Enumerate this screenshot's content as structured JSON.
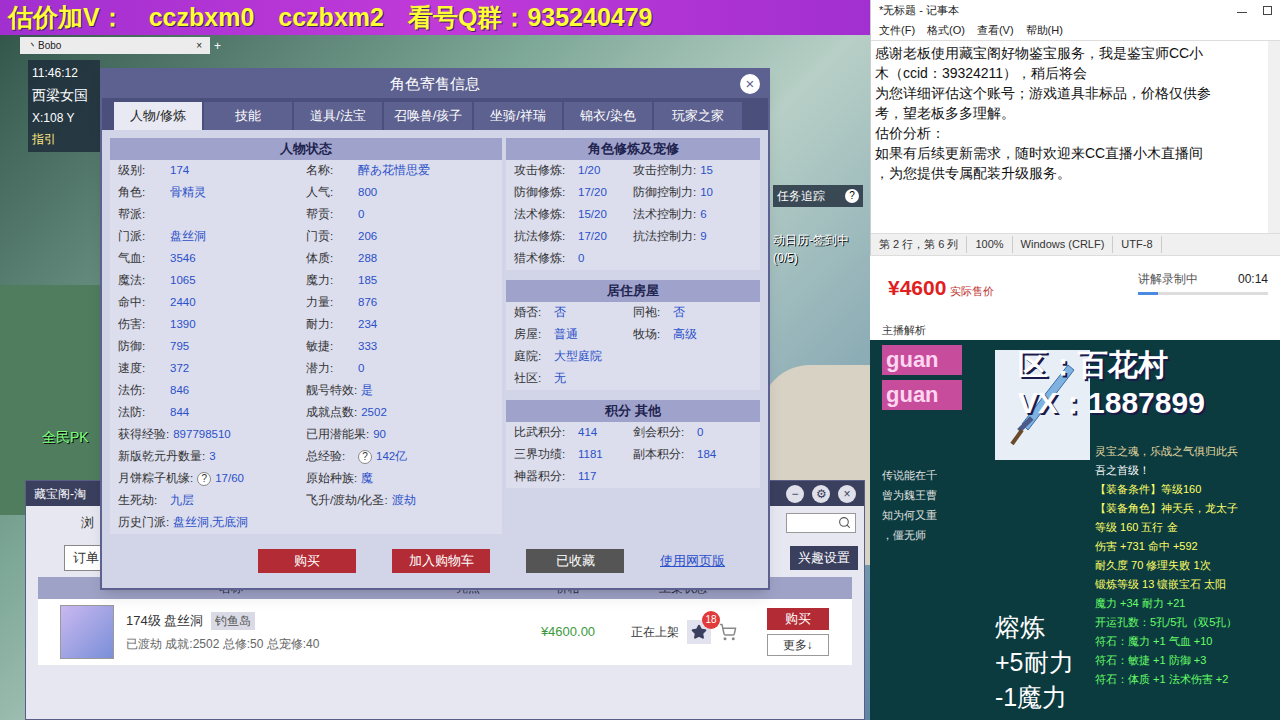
{
  "banner": {
    "segments": [
      "估价加V：",
      "cczbxm0",
      "cczbxm2",
      "看号Q群：935240479"
    ]
  },
  "game": {
    "browser_tab": {
      "title": "丶Bobo",
      "close": "×",
      "add": "+"
    },
    "hud": {
      "time": "11:46:12",
      "map": "西梁女国",
      "coords": "X:108 Y",
      "guide": "指引",
      "pk": "全民PK",
      "task": "任务追踪",
      "task_help": "?",
      "calendar": "动日历-签到中",
      "calendar_count": "(0/5)"
    }
  },
  "dialog": {
    "title": "角色寄售信息",
    "close": "×",
    "tabs": [
      {
        "label": "人物/修炼",
        "selected": true
      },
      {
        "label": "技能",
        "selected": false
      },
      {
        "label": "道具/法宝",
        "selected": false
      },
      {
        "label": "召唤兽/孩子",
        "selected": false
      },
      {
        "label": "坐骑/祥瑞",
        "selected": false
      },
      {
        "label": "锦衣/染色",
        "selected": false
      },
      {
        "label": "玩家之家",
        "selected": false
      }
    ],
    "status": {
      "title": "人物状态",
      "rows": [
        [
          {
            "label": "级别:",
            "value": "174"
          },
          {
            "label": "名称:",
            "value": "醉あ花惜思爱"
          }
        ],
        [
          {
            "label": "角色:",
            "value": "骨精灵"
          },
          {
            "label": "人气:",
            "value": "800"
          }
        ],
        [
          {
            "label": "帮派:",
            "value": ""
          },
          {
            "label": "帮贡:",
            "value": "0"
          }
        ],
        [
          {
            "label": "门派:",
            "value": "盘丝洞"
          },
          {
            "label": "门贡:",
            "value": "206"
          }
        ],
        [
          {
            "label": "气血:",
            "value": "3546"
          },
          {
            "label": "体质:",
            "value": "288"
          }
        ],
        [
          {
            "label": "魔法:",
            "value": "1065"
          },
          {
            "label": "魔力:",
            "value": "185"
          }
        ],
        [
          {
            "label": "命中:",
            "value": "2440"
          },
          {
            "label": "力量:",
            "value": "876"
          }
        ],
        [
          {
            "label": "伤害:",
            "value": "1390"
          },
          {
            "label": "耐力:",
            "value": "234"
          }
        ],
        [
          {
            "label": "防御:",
            "value": "795"
          },
          {
            "label": "敏捷:",
            "value": "333"
          }
        ],
        [
          {
            "label": "速度:",
            "value": "372"
          },
          {
            "label": "潜力:",
            "value": "0"
          }
        ],
        [
          {
            "label": "法伤:",
            "value": "846"
          },
          {
            "label": "靓号特效:",
            "value": "是"
          }
        ],
        [
          {
            "label": "法防:",
            "value": "844"
          },
          {
            "label": "成就点数:",
            "value": "2502"
          }
        ],
        [
          {
            "label": "获得经验:",
            "value": "897798510"
          },
          {
            "label": "已用潜能果:",
            "value": "90"
          }
        ],
        [
          {
            "label": "新版乾元丹数量:",
            "value": "3"
          },
          {
            "label": "总经验:",
            "value": "142亿",
            "hint": "?"
          }
        ],
        [
          {
            "label": "月饼粽子机缘:",
            "value": "17/60",
            "hint": "?"
          },
          {
            "label": "原始种族:",
            "value": "魔"
          }
        ],
        [
          {
            "label": "生死劫:",
            "value": "九层"
          },
          {
            "label": "飞升/渡劫/化圣:",
            "value": "渡劫"
          }
        ],
        [
          {
            "label": "历史门派:",
            "value": "盘丝洞,无底洞"
          }
        ]
      ]
    },
    "cultivation": {
      "title": "角色修炼及宠修",
      "rows": [
        [
          {
            "label": "攻击修炼:",
            "value": "1/20"
          },
          {
            "label": "攻击控制力:",
            "value": "15"
          }
        ],
        [
          {
            "label": "防御修炼:",
            "value": "17/20"
          },
          {
            "label": "防御控制力:",
            "value": "10"
          }
        ],
        [
          {
            "label": "法术修炼:",
            "value": "15/20"
          },
          {
            "label": "法术控制力:",
            "value": "6"
          }
        ],
        [
          {
            "label": "抗法修炼:",
            "value": "17/20"
          },
          {
            "label": "抗法控制力:",
            "value": "9"
          }
        ],
        [
          {
            "label": "猎术修炼:",
            "value": "0"
          }
        ]
      ]
    },
    "housing": {
      "title": "居住房屋",
      "rows": [
        [
          {
            "label": "婚否:",
            "value": "否"
          },
          {
            "label": "同袍:",
            "value": "否"
          }
        ],
        [
          {
            "label": "房屋:",
            "value": "普通"
          },
          {
            "label": "牧场:",
            "value": "高级"
          }
        ],
        [
          {
            "label": "庭院:",
            "value": "大型庭院"
          }
        ],
        [
          {
            "label": "社区:",
            "value": "无"
          }
        ]
      ]
    },
    "points": {
      "title": "积分 其他",
      "rows": [
        [
          {
            "label": "比武积分:",
            "value": "414"
          },
          {
            "label": "剑会积分:",
            "value": "0"
          }
        ],
        [
          {
            "label": "三界功绩:",
            "value": "1181"
          },
          {
            "label": "副本积分:",
            "value": "184"
          }
        ],
        [
          {
            "label": "神器积分:",
            "value": "117"
          }
        ]
      ]
    },
    "buttons": [
      {
        "label": "购买",
        "kind": "primary"
      },
      {
        "label": "加入购物车",
        "kind": "primary"
      },
      {
        "label": "已收藏",
        "kind": "muted"
      },
      {
        "label": "使用网页版",
        "kind": "link"
      }
    ]
  },
  "market": {
    "title": "藏宝阁-淘",
    "nav": "浏",
    "controls": [
      "−",
      "⚙",
      "×"
    ],
    "order_button": "订单",
    "interest_button": "兴趣设置",
    "columns": [
      "名称",
      "亮点",
      "价格",
      "上架状态"
    ],
    "rows": [
      {
        "title": "174级 盘丝洞",
        "server": "钓鱼岛",
        "summary": "已渡劫 成就:2502 总修:50 总宠修:40",
        "price": "¥4600.00",
        "status": "正在上架",
        "favorites": "18",
        "buy": "购买",
        "more": "更多↓"
      }
    ]
  },
  "notepad": {
    "title": "*无标题 - 记事本",
    "menu": [
      "文件(F)",
      "格式(O)",
      "查看(V)",
      "帮助(H)"
    ],
    "lines": [
      "感谢老板使用藏宝阁好物鉴宝服务，我是鉴宝师CC小",
      "木（ccid：39324211），稍后将会",
      "为您详细评估这个账号；游戏道具非标品，价格仅供参",
      "考，望老板多多理解。",
      "估价分析：",
      "如果有后续更新需求，随时欢迎来CC直播小木直播间",
      "，为您提供专属配装升级服务。"
    ],
    "status": [
      "第 2 行，第 6 列",
      "100%",
      "Windows (CRLF)",
      "UTF-8"
    ]
  },
  "price": {
    "amount": "¥4600",
    "label": "实际售价",
    "recording": "讲解录制中",
    "elapsed": "00:14",
    "level": 0.15,
    "section": "主播解析"
  },
  "item": {
    "watermark": [
      "guan",
      "guan"
    ],
    "region": "区：百花村",
    "contact": "VX：1887899",
    "lore": [
      "传说能在千",
      "曾为魏王曹",
      "知为何又重",
      "，僵无师"
    ],
    "smelt": {
      "title": "熔炼",
      "lines": [
        "+5耐力",
        "-1魔力"
      ]
    },
    "lines": [
      {
        "text": "灵宝之魂，乐战之气俱归此兵",
        "color": "#e6d9a0"
      },
      {
        "text": "吾之首级！",
        "color": "#ffffff"
      },
      {
        "text": "【装备条件】等级160",
        "color": "#ffff66"
      },
      {
        "text": "【装备角色】神天兵，龙太子",
        "color": "#ffff66"
      },
      {
        "text": "等级 160 五行 金",
        "color": "#ffff66"
      },
      {
        "text": "伤害 +731 命中 +592",
        "color": "#ffff66"
      },
      {
        "text": "耐久度 70 修理失败 1次",
        "color": "#ffff66"
      },
      {
        "text": "锻炼等级 13 镶嵌宝石 太阳",
        "color": "#ffff66"
      },
      {
        "text": "魔力 +34 耐力 +21",
        "color": "#66ff66"
      },
      {
        "text": "开运孔数：5孔/5孔（双5孔）",
        "color": "#66ff66"
      },
      {
        "text": "符石：魔力 +1 气血 +10",
        "color": "#66ff66"
      },
      {
        "text": "符石：敏捷 +1 防御 +3",
        "color": "#66ff66"
      },
      {
        "text": "符石：体质 +1 法术伤害 +2",
        "color": "#66ff66"
      }
    ]
  }
}
